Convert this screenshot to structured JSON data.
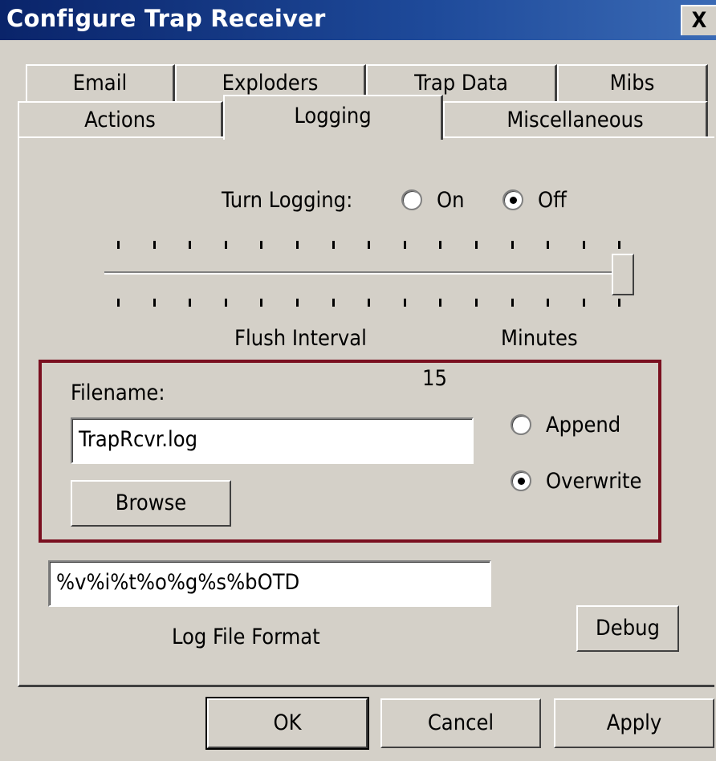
{
  "window": {
    "title": "Configure Trap Receiver",
    "close_glyph": "X"
  },
  "tabs_back": [
    "Email",
    "Exploders",
    "Trap Data",
    "Mibs"
  ],
  "tabs_front": [
    "Actions",
    "Logging",
    "Miscellaneous"
  ],
  "active_tab": "Logging",
  "logging": {
    "turn_label": "Turn Logging:",
    "on_label": "On",
    "off_label": "Off",
    "selected": "Off",
    "flush_label": "Flush Interval",
    "minutes_label": "Minutes",
    "slider_value": 15,
    "slider_position_fraction": 1.0
  },
  "file": {
    "value_label": "15",
    "filename_label": "Filename:",
    "filename_value": "TrapRcvr.log",
    "browse_label": "Browse",
    "append_label": "Append",
    "overwrite_label": "Overwrite",
    "mode_selected": "Overwrite",
    "highlight_color": "#7a1020"
  },
  "format": {
    "value": "%v%i%t%o%g%s%bOTD",
    "label": "Log File Format",
    "debug_label": "Debug"
  },
  "footer": {
    "ok_label": "OK",
    "cancel_label": "Cancel",
    "apply_label": "Apply"
  },
  "colors": {
    "face": "#d4d0c8",
    "title_bar": "#0a246a"
  }
}
